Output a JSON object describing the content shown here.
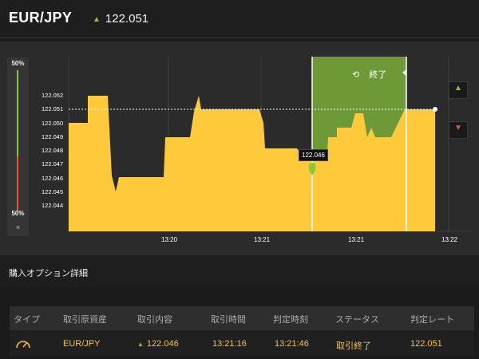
{
  "header": {
    "pair": "EUR/JPY",
    "rate": "122.051"
  },
  "gauge": {
    "top_label": "50%",
    "bottom_label": "50%",
    "close": "×"
  },
  "chart": {
    "y_ticks": [
      "122.052",
      "122.051",
      "122.050",
      "122.049",
      "122.048",
      "122.047",
      "122.046",
      "122.045",
      "122.044"
    ],
    "x_ticks": [
      "13:20",
      "13:21",
      "13:21",
      "13:22"
    ],
    "end_label": "終了",
    "tooltip": "122.046",
    "colors": {
      "area": "#ffc93c",
      "win_zone": "#6d9a37",
      "up": "#8cc63f",
      "down": "#e2572f"
    }
  },
  "detail": {
    "title": "購入オプション詳細",
    "columns": [
      "タイプ",
      "取引原資産",
      "取引内容",
      "取引時間",
      "判定時刻",
      "ステータス",
      "判定レート"
    ],
    "row": {
      "type_icon": "gauge-icon",
      "asset": "EUR/JPY",
      "content": "122.046",
      "trade_time": "13:21:16",
      "judge_time": "13:21:46",
      "status": "取引終了",
      "rate": "122.051"
    }
  }
}
